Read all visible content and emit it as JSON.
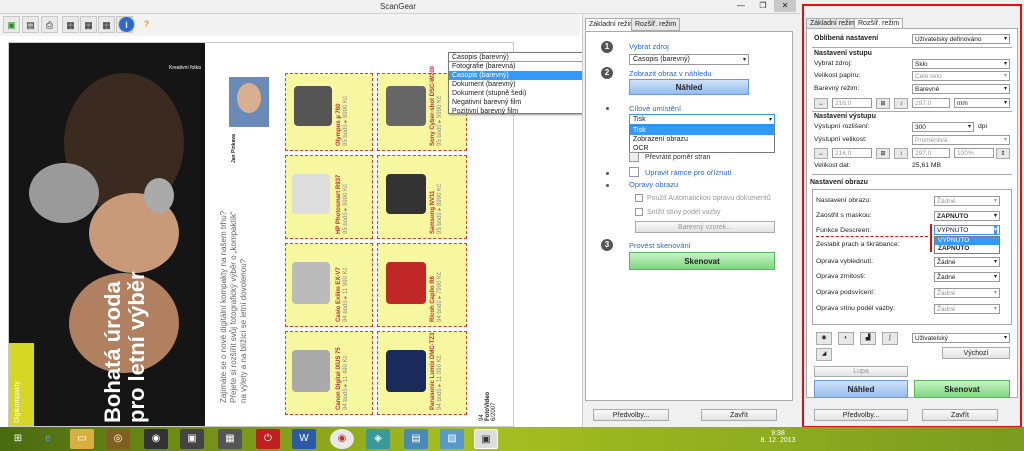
{
  "window": {
    "title": "ScanGear",
    "min": "—",
    "max": "❐",
    "close": "✕"
  },
  "toolbar": {
    "icons": [
      "scan-icon",
      "save-icon",
      "print-icon",
      "layout1-icon",
      "layout2-icon",
      "layout3-icon",
      "layout4-icon",
      "info-icon",
      "help-icon"
    ]
  },
  "magazine": {
    "headline": "Bohatá úroda\npro letní výběr",
    "section": "Digikompakty",
    "intro": [
      "Zajímáte se o nové digitální kompakty na našem trhu?",
      "Přejete si rozšířit svůj fotografický výběr o „kompaktík“",
      "na výlety a na blížící se letní dovolenou?"
    ],
    "footer_page": "94",
    "footer_brand": "FotoVideo",
    "footer_date": "6/2007",
    "author_name": "Jan Pinkava",
    "corner_label": "Kreativní fotka",
    "cameras": [
      {
        "name": "Olympus µ 780",
        "price": "95 bodů ▸ 8990 Kč"
      },
      {
        "name": "HP Photosmart R937",
        "price": "95 bodů ▸ 9990 Kč"
      },
      {
        "name": "Casio Exilim EX-V7",
        "price": "94 bodů ▸ 11 990 Kč"
      },
      {
        "name": "Canon Digital IXUS 75",
        "price": "94 bodů ▸ 11 490 Kč"
      },
      {
        "name": "Sony Cyber-shot DSC-W200",
        "price": "95 bodů ▸ 9990 Kč"
      },
      {
        "name": "Samsung NV11",
        "price": "95 bodů ▸ 8990 Kč"
      },
      {
        "name": "Ricoh Caplio R6",
        "price": "94 bodů ▸ 7990 Kč"
      },
      {
        "name": "Panasonic Lumix DMC-TZ3",
        "price": "94 bodů ▸ 11 990 Kč"
      }
    ]
  },
  "source_dropdown": {
    "value": "Časopis (barevný)",
    "options": [
      "Fotografie (barevná)",
      "Časopis (barevný)",
      "Dokument (barevný)",
      "Dokument (stupně šedi)",
      "Negativní barevný film",
      "Pozitivní barevný film"
    ],
    "selected": 1
  },
  "basic": {
    "tabs": [
      "Základní režim",
      "Rozšíř. režim"
    ],
    "step1_num": "1",
    "step1_label": "Vybrat zdroj",
    "step2_num": "2",
    "step2_label": "Zobrazit obraz v náhledu",
    "preview_btn": "Náhled",
    "dest_label": "Cílové umístění",
    "dest_value": "Tisk",
    "dest_options": [
      "Tisk",
      "Zobrazení obrazu",
      "OCR"
    ],
    "flip_label": "Převrátit poměr stran",
    "crop_label": "Upravit rámce pro oříznutí",
    "corr_label": "Opravy obrazu",
    "auto_label": "Použít Automatickou opravu dokumentů",
    "shadow_label": "Snížit stíny podél vazby",
    "color_btn": "Barevný vzorek...",
    "step3_num": "3",
    "step3_label": "Provést skenování",
    "scan_btn": "Skenovat",
    "prefs_btn": "Předvolby...",
    "close_btn": "Zavřít"
  },
  "advanced": {
    "tabs": [
      "Základní režim",
      "Rozšíř. režim"
    ],
    "fav_label": "Oblíbená nastavení",
    "fav_value": "Uživatelsky definováno",
    "input_hdr": "Nastavení vstupu",
    "src_label": "Vybrat zdroj:",
    "src_value": "Sklo",
    "paper_label": "Velikost papíru:",
    "paper_value": "Celé sklo",
    "color_label": "Barevný režim:",
    "color_value": "Barevně",
    "in_w": "216,0",
    "in_h": "297,0",
    "in_unit": "mm",
    "output_hdr": "Nastavení výstupu",
    "res_label": "Výstupní rozlišení:",
    "res_value": "300",
    "res_unit": "dpi",
    "size_label": "Výstupní velikost:",
    "size_value": "Proměnlivá",
    "out_w": "216,0",
    "out_h": "297,0",
    "out_pct": "100%",
    "data_label": "Velikost dat:",
    "data_value": "25,61 MB",
    "image_hdr": "Nastavení obrazu",
    "rows": [
      {
        "label": "Nastavení obrazu:",
        "value": "Žádné",
        "dim": true
      },
      {
        "label": "Zaostřit s maskou:",
        "value": "ZAPNUTO",
        "dim": false
      },
      {
        "label": "Funkce Descreen:",
        "value": "VYPNUTO",
        "dim": false
      },
      {
        "label": "Zeslabit prach a škrábance:",
        "value": "",
        "dim": false
      },
      {
        "label": "Oprava vyblednutí:",
        "value": "Žádné",
        "dim": false
      },
      {
        "label": "Oprava zrnitosti:",
        "value": "Žádné",
        "dim": false
      },
      {
        "label": "Oprava podsvícení:",
        "value": "Žádné",
        "dim": true
      },
      {
        "label": "Oprava stínu podél vazby:",
        "value": "Žádné",
        "dim": true
      }
    ],
    "descreen_options": [
      "VYPNUTO",
      "ZAPNUTO"
    ],
    "tone_value": "Uživatelský",
    "reset_btn": "Výchozí",
    "zoom_btn": "Lupa",
    "preview_btn": "Náhled",
    "scan_btn": "Skenovat",
    "prefs_btn": "Předvolby...",
    "close_btn": "Zavřít"
  },
  "taskbar": {
    "time": "9:38",
    "date": "8. 12. 2013"
  }
}
